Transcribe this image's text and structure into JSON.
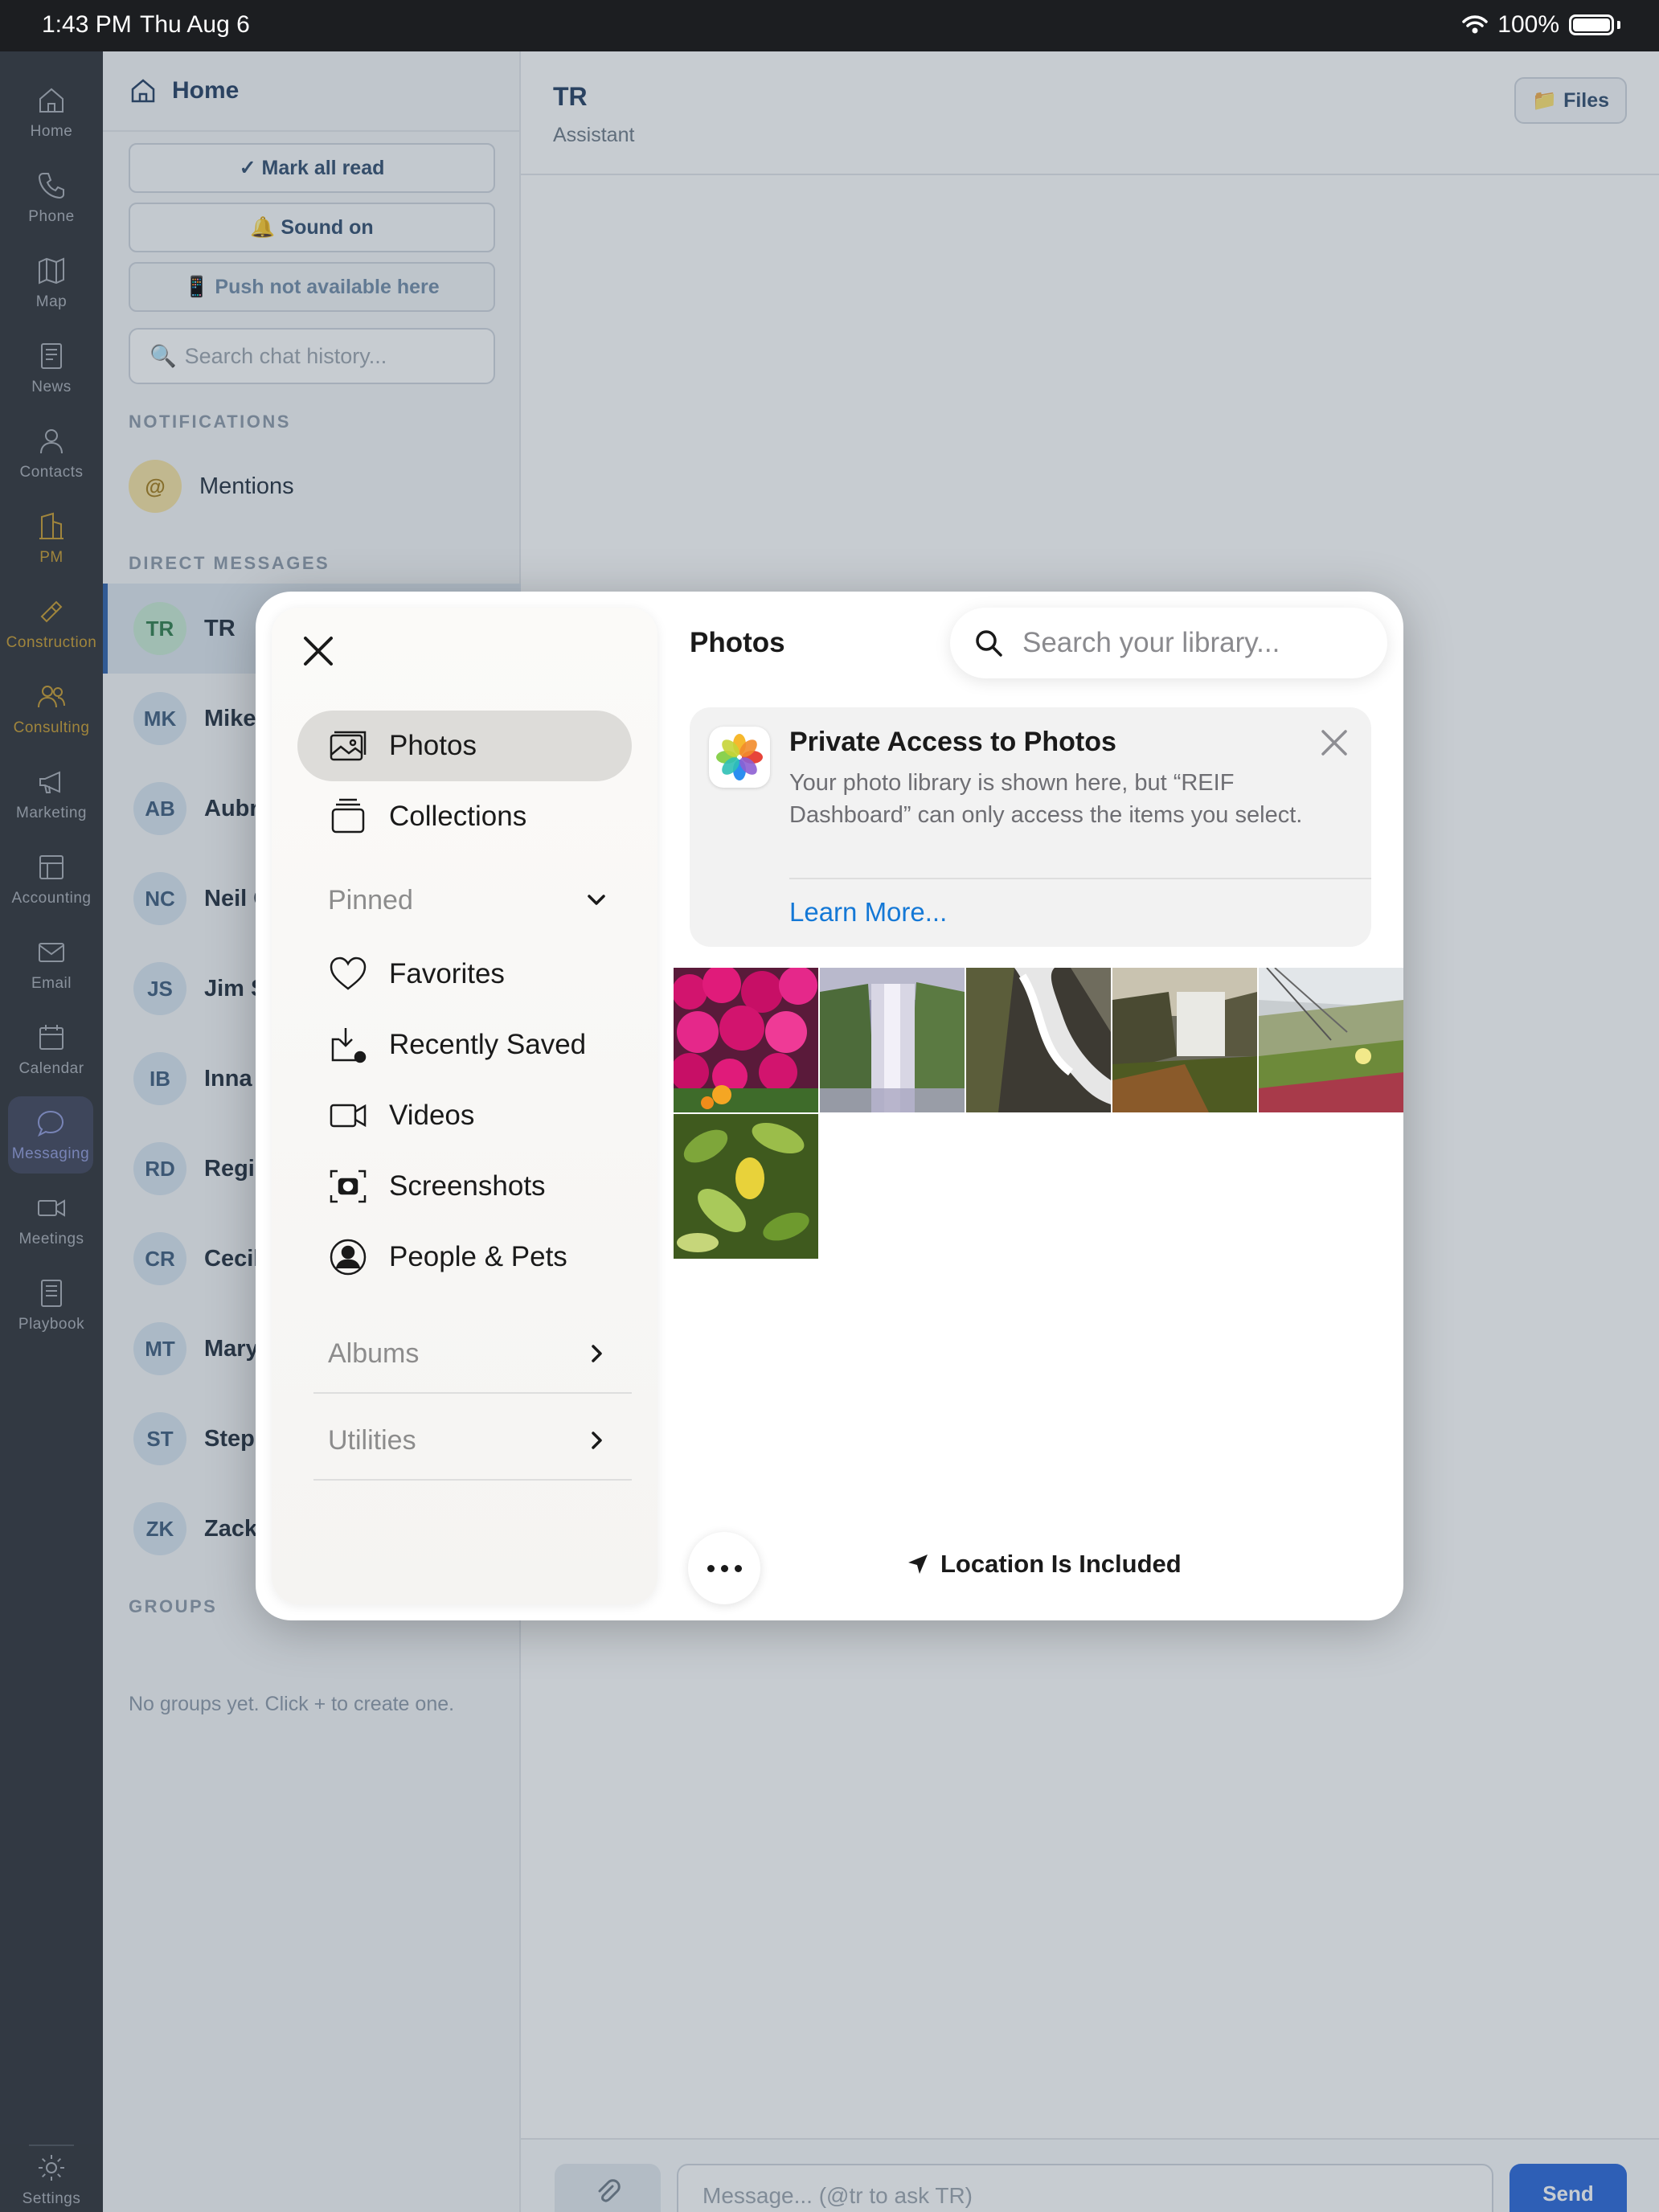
{
  "status_bar": {
    "time": "1:43 PM",
    "date": "Thu Aug 6",
    "battery": "100%"
  },
  "rail": {
    "items": [
      {
        "label": "Home",
        "icon": "home-icon"
      },
      {
        "label": "Phone",
        "icon": "phone-icon"
      },
      {
        "label": "Map",
        "icon": "map-icon"
      },
      {
        "label": "News",
        "icon": "news-icon"
      },
      {
        "label": "Contacts",
        "icon": "contacts-icon"
      },
      {
        "label": "PM",
        "icon": "building-icon"
      },
      {
        "label": "Construction",
        "icon": "hammer-icon"
      },
      {
        "label": "Consulting",
        "icon": "people-icon"
      },
      {
        "label": "Marketing",
        "icon": "megaphone-icon"
      },
      {
        "label": "Accounting",
        "icon": "ledger-icon"
      },
      {
        "label": "Email",
        "icon": "mail-icon"
      },
      {
        "label": "Calendar",
        "icon": "calendar-icon"
      },
      {
        "label": "Messaging",
        "icon": "chat-bubble-icon"
      },
      {
        "label": "Meetings",
        "icon": "video-icon"
      },
      {
        "label": "Playbook",
        "icon": "book-icon"
      }
    ],
    "settings_label": "Settings"
  },
  "sidebar": {
    "title": "Home",
    "mark_read": "✓ Mark all read",
    "sound": "🔔 Sound on",
    "push": "📱 Push not available here",
    "search_placeholder": "Search chat history...",
    "notifications_header": "NOTIFICATIONS",
    "mentions_label": "Mentions",
    "mentions_symbol": "@",
    "dm_header": "DIRECT MESSAGES",
    "dms": [
      {
        "initials": "TR",
        "name": "TR"
      },
      {
        "initials": "MK",
        "name": "Mike"
      },
      {
        "initials": "AB",
        "name": "Aubre"
      },
      {
        "initials": "NC",
        "name": "Neil C"
      },
      {
        "initials": "JS",
        "name": "Jim S"
      },
      {
        "initials": "IB",
        "name": "Inna I"
      },
      {
        "initials": "RD",
        "name": "Regie"
      },
      {
        "initials": "CR",
        "name": "Cecil"
      },
      {
        "initials": "MT",
        "name": "Mary"
      },
      {
        "initials": "ST",
        "name": "Steph"
      },
      {
        "initials": "ZK",
        "name": "Zack"
      }
    ],
    "groups_header": "GROUPS",
    "groups_empty": "No groups yet. Click + to create one."
  },
  "chat": {
    "title": "TR",
    "subtitle": "Assistant",
    "files_label": "Files",
    "message_placeholder": "Message... (@tr to ask TR)",
    "send_label": "Send"
  },
  "picker": {
    "nav": {
      "photos": "Photos",
      "collections": "Collections",
      "pinned": "Pinned",
      "favorites": "Favorites",
      "recently_saved": "Recently Saved",
      "videos": "Videos",
      "screenshots": "Screenshots",
      "people_pets": "People & Pets",
      "albums": "Albums",
      "utilities": "Utilities"
    },
    "title": "Photos",
    "search_placeholder": "Search your library...",
    "privacy": {
      "title": "Private Access to Photos",
      "body": "Your photo library is shown here, but “REIF Dashboard” can only access the items you select.",
      "link": "Learn More..."
    },
    "location_label": "Location Is Included"
  }
}
